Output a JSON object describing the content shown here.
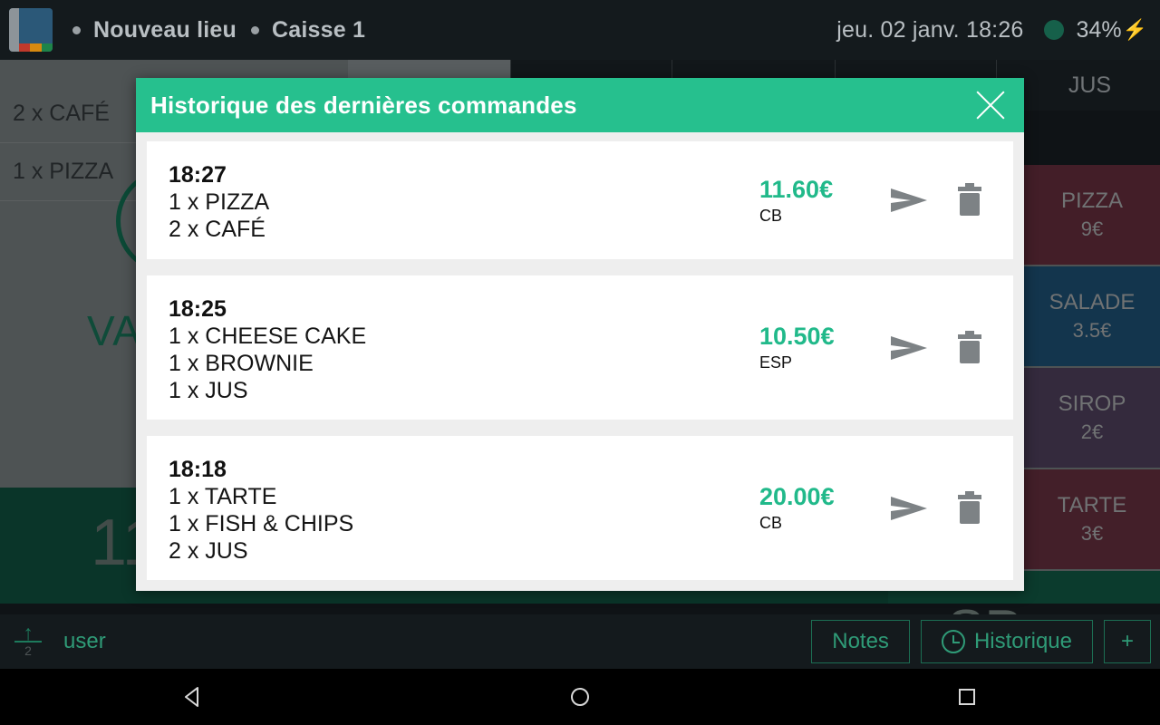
{
  "topbar": {
    "app_icon": "book-icon",
    "breadcrumb": [
      {
        "label": "Nouveau lieu"
      },
      {
        "label": "Caisse 1"
      }
    ],
    "datetime": "jeu. 02 janv. 18:26",
    "battery_percent": "34%",
    "battery_bolt": "⚡",
    "status_dot_color": "#16604a"
  },
  "background": {
    "order_lines": [
      {
        "text": "2 x CAFÉ"
      },
      {
        "text": "1 x PIZZA"
      }
    ],
    "validate_text": "VA",
    "total_amount": "11",
    "payment_button": "SP",
    "category_tab": "JUS",
    "products": [
      {
        "name": "PIZZA",
        "price": "9€",
        "color": "#5d2a38"
      },
      {
        "name": "SALADE",
        "price": "3.5€",
        "color": "#1b4a6b"
      },
      {
        "name": "SIROP",
        "price": "2€",
        "color": "#493b55"
      },
      {
        "name": "TARTE",
        "price": "3€",
        "color": "#5d2b3a"
      }
    ]
  },
  "modal": {
    "title": "Historique des dernières commandes",
    "close_icon": "close-icon",
    "header_color": "#26c08e",
    "orders": [
      {
        "time": "18:27",
        "items": [
          {
            "text": "1 x PIZZA"
          },
          {
            "text": "2 x CAFÉ"
          }
        ],
        "price": "11.60€",
        "payment": "CB",
        "send_icon": "send-icon",
        "delete_icon": "trash-icon"
      },
      {
        "time": "18:25",
        "items": [
          {
            "text": "1 x CHEESE CAKE"
          },
          {
            "text": "1 x BROWNIE"
          },
          {
            "text": "1 x JUS"
          }
        ],
        "price": "10.50€",
        "payment": "ESP",
        "send_icon": "send-icon",
        "delete_icon": "trash-icon"
      },
      {
        "time": "18:18",
        "items": [
          {
            "text": "1 x TARTE"
          },
          {
            "text": "1 x FISH & CHIPS"
          },
          {
            "text": "2 x JUS"
          }
        ],
        "price": "20.00€",
        "payment": "CB",
        "send_icon": "send-icon",
        "delete_icon": "trash-icon"
      }
    ]
  },
  "bottombar": {
    "upload_icon": "upload-arrow-icon",
    "upload_count": "2",
    "user": "user",
    "notes_label": "Notes",
    "history_label": "Historique",
    "history_icon": "clock-icon",
    "add_label": "+"
  },
  "navbar": {
    "back": "back-triangle-icon",
    "home": "home-circle-icon",
    "recents": "recents-square-icon"
  }
}
